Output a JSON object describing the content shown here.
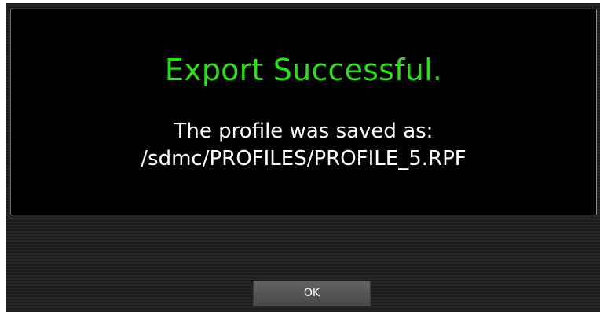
{
  "dialog": {
    "title": "Export Successful.",
    "message_line_1": "The profile was saved as:",
    "message_line_2": "/sdmc/PROFILES/PROFILE_5.RPF",
    "ok_label": "OK"
  },
  "colors": {
    "title_green": "#2fdc1c",
    "panel_background": "#000000",
    "message_text": "#ffffff"
  }
}
